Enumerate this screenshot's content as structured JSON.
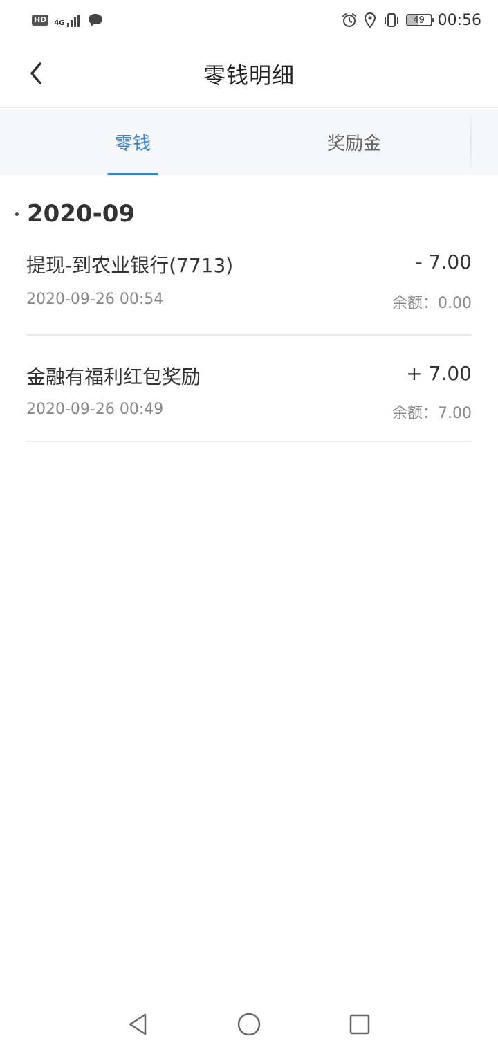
{
  "status_bar": {
    "hd": "HD",
    "network": "4G",
    "battery_level": 49,
    "battery_text": "49",
    "time": "00:56",
    "icons": [
      "signal-icon",
      "message-icon",
      "alarm-icon",
      "location-icon",
      "vibrate-icon",
      "battery-icon"
    ]
  },
  "header": {
    "title": "零钱明细"
  },
  "tabs": [
    {
      "label": "零钱",
      "active": true
    },
    {
      "label": "奖励金",
      "active": false
    }
  ],
  "colors": {
    "accent": "#3a86d6",
    "tab_bg": "#f6f7f9",
    "divider": "#ebebeb"
  },
  "month": {
    "label": "2020-09"
  },
  "records": [
    {
      "title": "提现-到农业银行(7713)",
      "amount": "- 7.00",
      "time": "2020-09-26 00:54",
      "balance": "余额：0.00"
    },
    {
      "title": "金融有福利红包奖励",
      "amount": "+ 7.00",
      "time": "2020-09-26 00:49",
      "balance": "余额：7.00"
    }
  ]
}
